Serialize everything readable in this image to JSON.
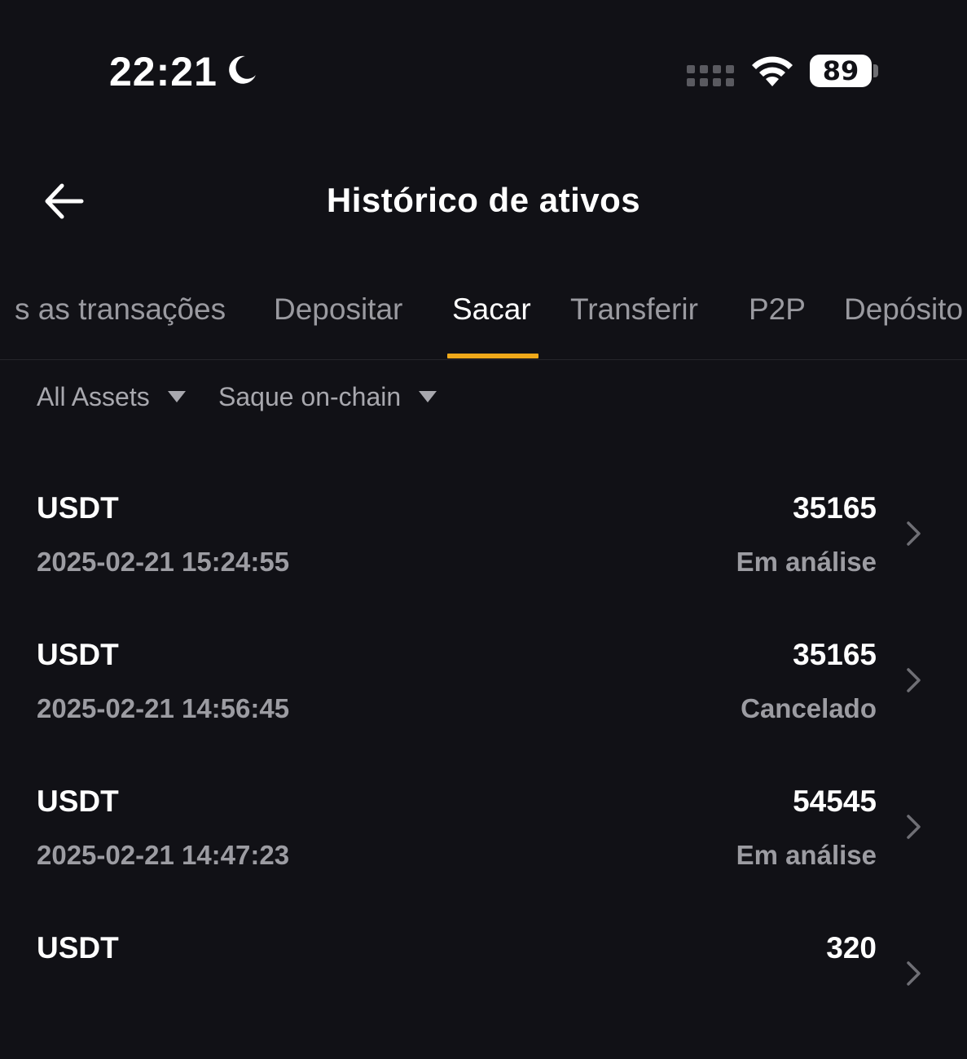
{
  "status_bar": {
    "time": "22:21",
    "battery_level": "89",
    "icons": [
      "moon-icon",
      "signal-icon",
      "wifi-icon",
      "battery-icon"
    ]
  },
  "header": {
    "title": "Histórico de ativos",
    "back_icon": "arrow-left-icon"
  },
  "tabs": [
    {
      "label": "s as transações",
      "active": false
    },
    {
      "label": "Depositar",
      "active": false
    },
    {
      "label": "Sacar",
      "active": true
    },
    {
      "label": "Transferir",
      "active": false
    },
    {
      "label": "P2P",
      "active": false
    },
    {
      "label": "Depósito",
      "active": false
    }
  ],
  "filters": {
    "asset": "All Assets",
    "type": "Saque on-chain"
  },
  "colors": {
    "background": "#111116",
    "accent": "#f0a91a",
    "text_primary": "#ffffff",
    "text_secondary": "#9c9ca2"
  },
  "transactions": [
    {
      "asset": "USDT",
      "datetime": "2025-02-21 15:24:55",
      "amount": "35165",
      "status": "Em análise"
    },
    {
      "asset": "USDT",
      "datetime": "2025-02-21 14:56:45",
      "amount": "35165",
      "status": "Cancelado"
    },
    {
      "asset": "USDT",
      "datetime": "2025-02-21 14:47:23",
      "amount": "54545",
      "status": "Em análise"
    },
    {
      "asset": "USDT",
      "datetime": "",
      "amount": "320",
      "status": ""
    }
  ]
}
